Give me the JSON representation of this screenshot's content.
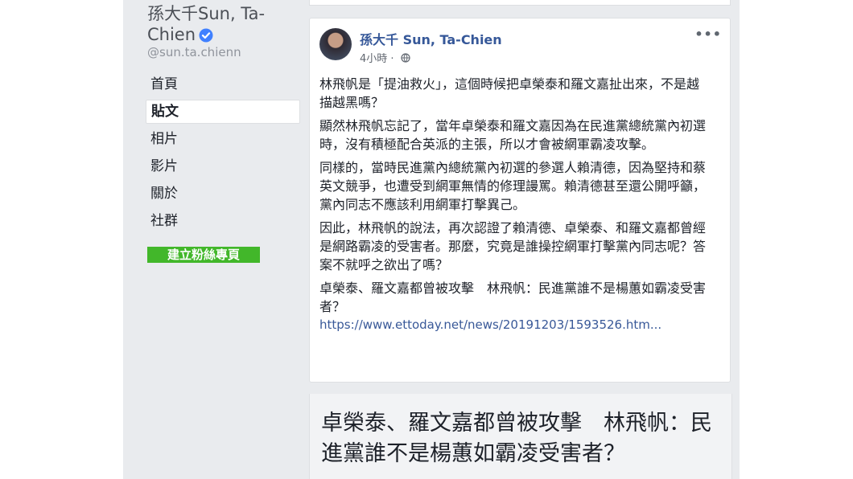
{
  "profile": {
    "name": "孫大千Sun, Ta-Chien",
    "handle": "@sun.ta.chienn"
  },
  "nav": {
    "items": [
      {
        "label": "首頁"
      },
      {
        "label": "貼文"
      },
      {
        "label": "相片"
      },
      {
        "label": "影片"
      },
      {
        "label": "關於"
      },
      {
        "label": "社群"
      }
    ],
    "active": "貼文",
    "create_page_label": "建立粉絲專頁"
  },
  "post": {
    "author": "孫大千 Sun, Ta-Chien",
    "time": "4小時",
    "more_label": "•••",
    "paragraphs": [
      "林飛帆是「提油救火」，這個時候把卓榮泰和羅文嘉扯出來，不是越描越黑嗎？",
      "顯然林飛帆忘記了，當年卓榮泰和羅文嘉因為在民進黨總統黨內初選時，沒有積極配合英派的主張，所以才會被網軍霸凌攻擊。",
      "同樣的，當時民進黨內總統黨內初選的參選人賴清德，因為堅持和蔡英文競爭，也遭受到網軍無情的修理謾罵。賴清德甚至還公開呼籲，黨內同志不應該利用網軍打擊異己。",
      "因此，林飛帆的說法，再次認證了賴清德、卓榮泰、和羅文嘉都曾經是網路霸凌的受害者。那麼，究竟是誰操控網軍打擊黨內同志呢？答案不就呼之欲出了嗎？",
      "卓榮泰、羅文嘉都曾被攻擊　林飛帆：民進黨誰不是楊蕙如霸凌受害者？"
    ],
    "link": "https://www.ettoday.net/news/20191203/1593526.htm..."
  },
  "preview": {
    "title": "卓榮泰、羅文嘉都曾被攻擊　林飛帆：民進黨誰不是楊蕙如霸凌受害者？"
  },
  "colors": {
    "link": "#365899",
    "verified": "#4080ff",
    "create_button": "#42b72a"
  },
  "icons": [
    "verified-badge-icon",
    "globe-icon",
    "more-options-icon"
  ]
}
